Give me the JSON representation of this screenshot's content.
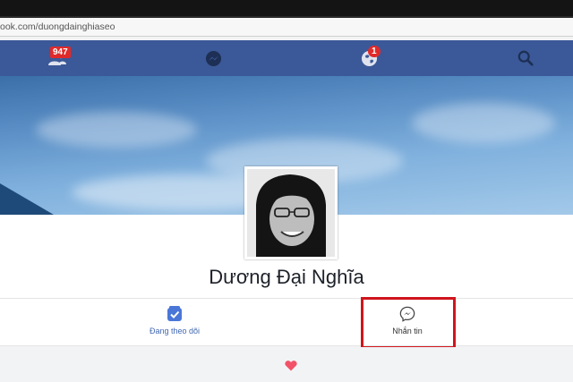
{
  "browser": {
    "url": "ook.com/duongdainghiaseo"
  },
  "navbar": {
    "friends_badge": "947",
    "notifications_badge": "1",
    "colors": {
      "bar": "#3b5998",
      "badge": "#e02a2a"
    }
  },
  "profile": {
    "name": "Dương Đại Nghĩa"
  },
  "actions": {
    "following_label": "Đang theo dõi",
    "message_label": "Nhắn tin"
  },
  "colors": {
    "highlight": "#d0151c",
    "heart": "#f25268",
    "link": "#4267b2"
  }
}
